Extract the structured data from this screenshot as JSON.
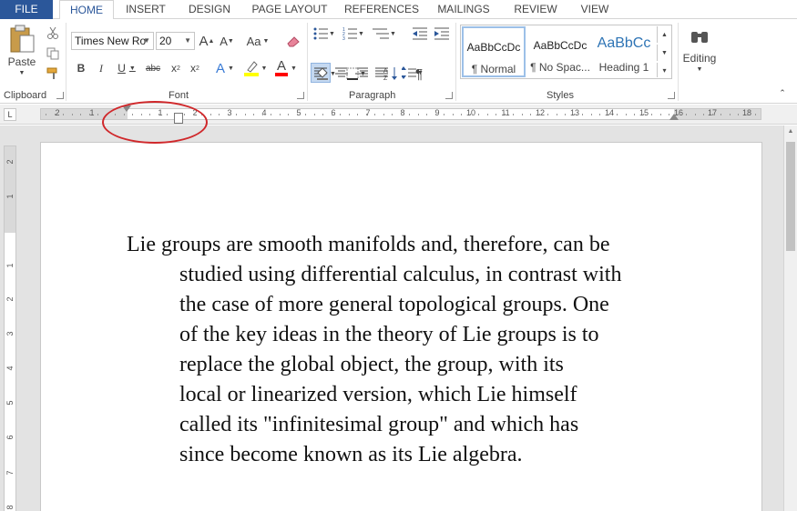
{
  "tabs": [
    "FILE",
    "HOME",
    "INSERT",
    "DESIGN",
    "PAGE LAYOUT",
    "REFERENCES",
    "MAILINGS",
    "REVIEW",
    "VIEW"
  ],
  "clipboard": {
    "paste_label": "Paste",
    "group_label": "Clipboard"
  },
  "font": {
    "name": "Times New Ro",
    "size": "20",
    "grow_label": "A",
    "shrink_label": "A",
    "change_case_label": "Aa",
    "bold_label": "B",
    "italic_label": "I",
    "underline_label": "U",
    "strike_label": "abc",
    "subscript_label": "x",
    "superscript_label": "x",
    "effects_label": "A",
    "color_label": "A",
    "group_label": "Font"
  },
  "paragraph": {
    "group_label": "Paragraph",
    "pilcrow": "¶"
  },
  "styles": {
    "items": [
      {
        "sample": "AaBbCcDc",
        "name": "¶ Normal"
      },
      {
        "sample": "AaBbCcDc",
        "name": "¶ No Spac..."
      },
      {
        "sample": "AaBbCc",
        "name": "Heading 1"
      }
    ],
    "group_label": "Styles"
  },
  "editing": {
    "label": "Editing"
  },
  "ruler": {
    "corner_label": "L",
    "numbers": [
      "2",
      "1",
      "1",
      "2",
      "3",
      "4",
      "5",
      "6",
      "7",
      "8",
      "9",
      "10",
      "11",
      "12",
      "13",
      "14",
      "15",
      "16",
      "17",
      "18"
    ]
  },
  "vruler": {
    "numbers": [
      "2",
      "1",
      "1",
      "2",
      "3",
      "4",
      "5",
      "6",
      "7",
      "8"
    ]
  },
  "document": {
    "lines": [
      "Lie groups are smooth manifolds and, therefore, can be",
      "studied using differential calculus, in contrast with",
      "the case of more general topological groups. One",
      "of the key ideas in the theory of Lie groups is to",
      "replace the global object, the group, with its",
      "local or linearized version, which Lie himself",
      "called its \"infinitesimal group\" and which has",
      "since become known as its Lie algebra."
    ]
  },
  "colors": {
    "file_tab": "#2b579a",
    "accent": "#2b579a",
    "annotation_circle": "#d0282b",
    "highlight": "#ffff00",
    "font_color": "#ff0000"
  }
}
